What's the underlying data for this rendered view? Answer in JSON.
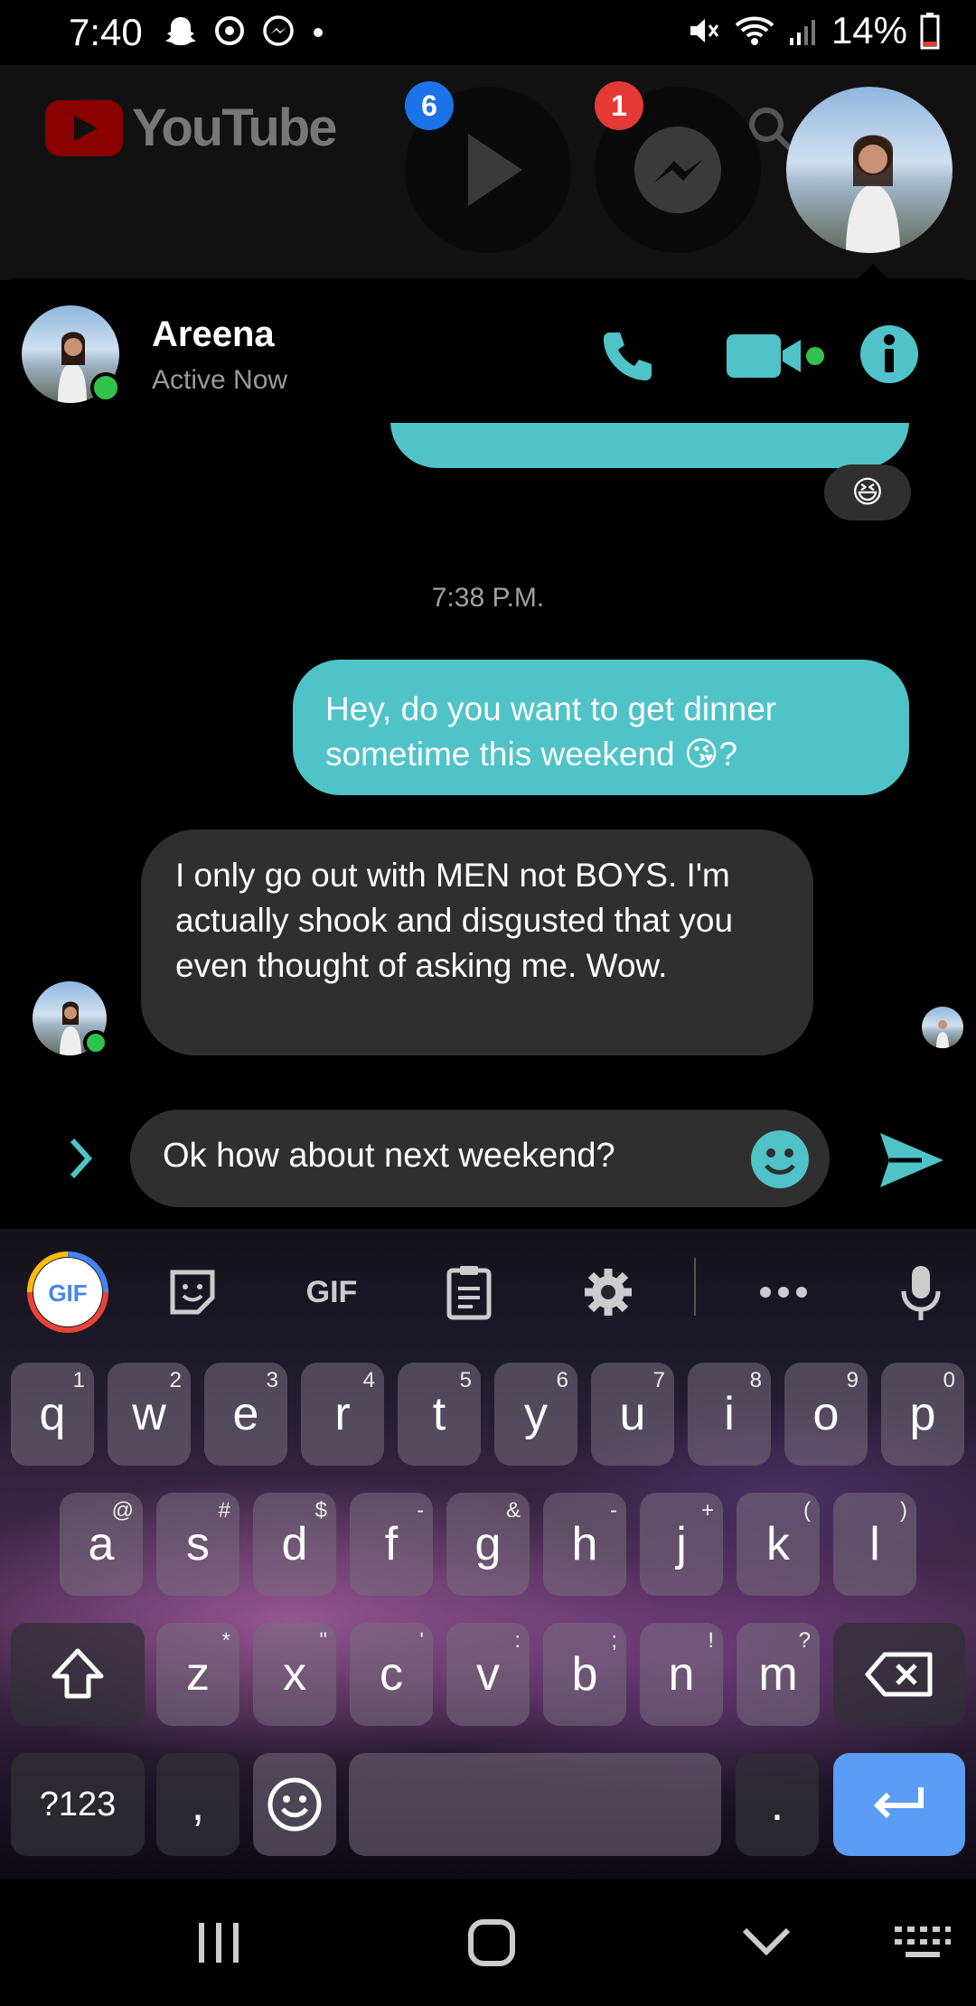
{
  "status_bar": {
    "time": "7:40",
    "battery": "14%"
  },
  "youtube": {
    "logo_text": "YouTube"
  },
  "chat_heads": {
    "play_badge": "6",
    "messenger_badge": "1"
  },
  "conversation": {
    "contact_name": "Areena",
    "contact_status": "Active Now",
    "reaction_emoji": "😆",
    "timestamp": "7:38 P.M.",
    "messages": [
      {
        "from": "me",
        "text": "Hey, do you want to get dinner sometime this weekend 😘?"
      },
      {
        "from": "them",
        "text": "I only go out with MEN not BOYS. I'm actually shook and disgusted that you even thought of asking me. Wow."
      }
    ]
  },
  "composer": {
    "value": "Ok how about next weekend?"
  },
  "keyboard": {
    "gif_label": "GIF",
    "row1": [
      {
        "k": "q",
        "h": "1"
      },
      {
        "k": "w",
        "h": "2"
      },
      {
        "k": "e",
        "h": "3"
      },
      {
        "k": "r",
        "h": "4"
      },
      {
        "k": "t",
        "h": "5"
      },
      {
        "k": "y",
        "h": "6"
      },
      {
        "k": "u",
        "h": "7"
      },
      {
        "k": "i",
        "h": "8"
      },
      {
        "k": "o",
        "h": "9"
      },
      {
        "k": "p",
        "h": "0"
      }
    ],
    "row2": [
      {
        "k": "a",
        "h": "@"
      },
      {
        "k": "s",
        "h": "#"
      },
      {
        "k": "d",
        "h": "$"
      },
      {
        "k": "f",
        "h": "-"
      },
      {
        "k": "g",
        "h": "&"
      },
      {
        "k": "h",
        "h": "-"
      },
      {
        "k": "j",
        "h": "+"
      },
      {
        "k": "k",
        "h": "("
      },
      {
        "k": "l",
        "h": ")"
      }
    ],
    "row3": [
      {
        "k": "z",
        "h": "*"
      },
      {
        "k": "x",
        "h": "\""
      },
      {
        "k": "c",
        "h": "'"
      },
      {
        "k": "v",
        "h": ":"
      },
      {
        "k": "b",
        "h": ";"
      },
      {
        "k": "n",
        "h": "!"
      },
      {
        "k": "m",
        "h": "?"
      }
    ],
    "symbols_label": "?123",
    "comma": ",",
    "period": "."
  },
  "colors": {
    "accent": "#4fc3c8",
    "enter": "#5b9cf5",
    "online": "#31c24d"
  }
}
